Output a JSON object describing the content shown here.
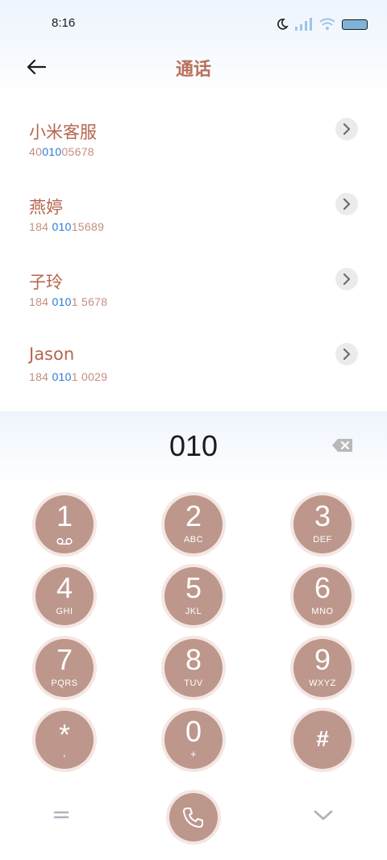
{
  "status_bar": {
    "time": "8:16"
  },
  "header": {
    "title": "通话"
  },
  "results": [
    {
      "name": "小米客服",
      "number_pre": "40",
      "number_match": "010",
      "number_post": "05678"
    },
    {
      "name": "燕婷",
      "number_pre": "184 ",
      "number_match": "010",
      "number_post": "15689"
    },
    {
      "name": "子玲",
      "number_pre": "184 ",
      "number_match": "010",
      "number_post": "1 5678"
    },
    {
      "name": "Jason",
      "number_pre": "184 ",
      "number_match": "010",
      "number_post": "1 0029"
    }
  ],
  "dialer": {
    "input": "010",
    "keys": [
      {
        "digit": "1",
        "letters": ""
      },
      {
        "digit": "2",
        "letters": "ABC"
      },
      {
        "digit": "3",
        "letters": "DEF"
      },
      {
        "digit": "4",
        "letters": "GHI"
      },
      {
        "digit": "5",
        "letters": "JKL"
      },
      {
        "digit": "6",
        "letters": "MNO"
      },
      {
        "digit": "7",
        "letters": "PQRS"
      },
      {
        "digit": "8",
        "letters": "TUV"
      },
      {
        "digit": "9",
        "letters": "WXYZ"
      },
      {
        "digit": "*",
        "letters": ","
      },
      {
        "digit": "0",
        "letters": "+"
      },
      {
        "digit": "#",
        "letters": ""
      }
    ]
  },
  "colors": {
    "accent": "#b6664e",
    "match_highlight": "#2b7ad4",
    "key_fill": "#bd978c"
  },
  "icons": {
    "back": "arrow-left-icon",
    "detail": "chevron-right-icon",
    "backspace": "backspace-icon",
    "voicemail": "voicemail-icon",
    "menu": "equals-menu-icon",
    "call": "phone-icon",
    "collapse": "chevron-down-icon"
  }
}
